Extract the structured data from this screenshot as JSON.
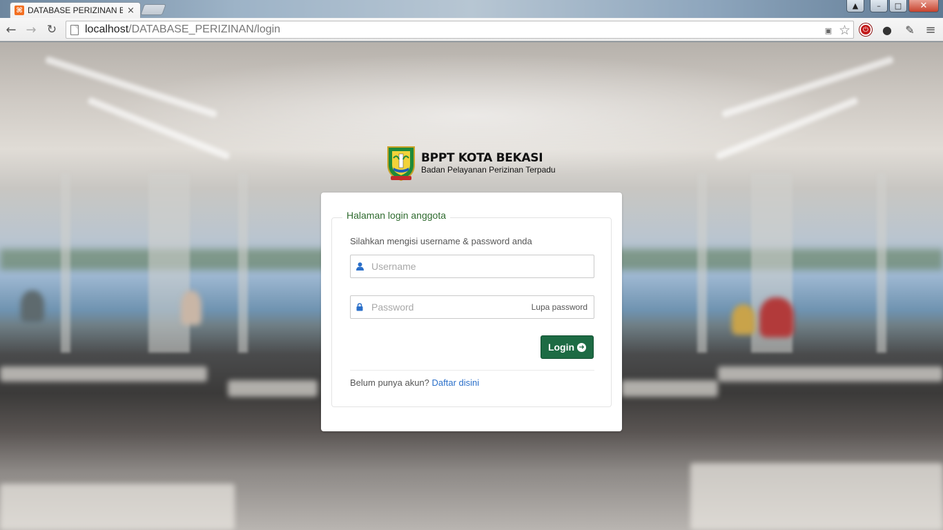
{
  "browser": {
    "tab_title": "DATABASE PERIZINAN BP",
    "tab_close": "×",
    "favicon": "xampp-icon",
    "url_host": "localhost",
    "url_path": "/DATABASE_PERIZINAN/login",
    "window_close": "✕"
  },
  "logo": {
    "title": "BPPT KOTA BEKASI",
    "subtitle": "Badan Pelayanan Perizinan Terpadu"
  },
  "login": {
    "legend": "Halaman login anggota",
    "hint": "Silahkan mengisi username & password anda",
    "username_placeholder": "Username",
    "password_placeholder": "Password",
    "forgot_label": "Lupa password",
    "button_label": "Login",
    "register_prompt": "Belum punya akun?",
    "register_link": "Daftar disini"
  },
  "colors": {
    "brand_green": "#1d6b44",
    "legend_green": "#2f6b2f",
    "link_blue": "#2a6fc9"
  }
}
